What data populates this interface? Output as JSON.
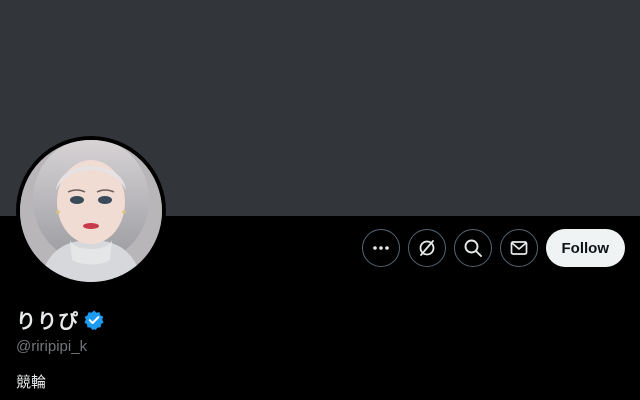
{
  "profile": {
    "display_name": "りりぴ",
    "handle": "@riripipi_k",
    "bio": "競輪"
  },
  "actions": {
    "more_icon": "more-horizontal-icon",
    "grok_icon": "grok-icon",
    "search_icon": "search-icon",
    "message_icon": "mail-icon",
    "follow_label": "Follow"
  },
  "colors": {
    "banner": "#32363a",
    "background": "#000000",
    "verified_badge": "#1d9bf0",
    "follow_bg": "#eff3f4",
    "muted_text": "#71767b"
  }
}
